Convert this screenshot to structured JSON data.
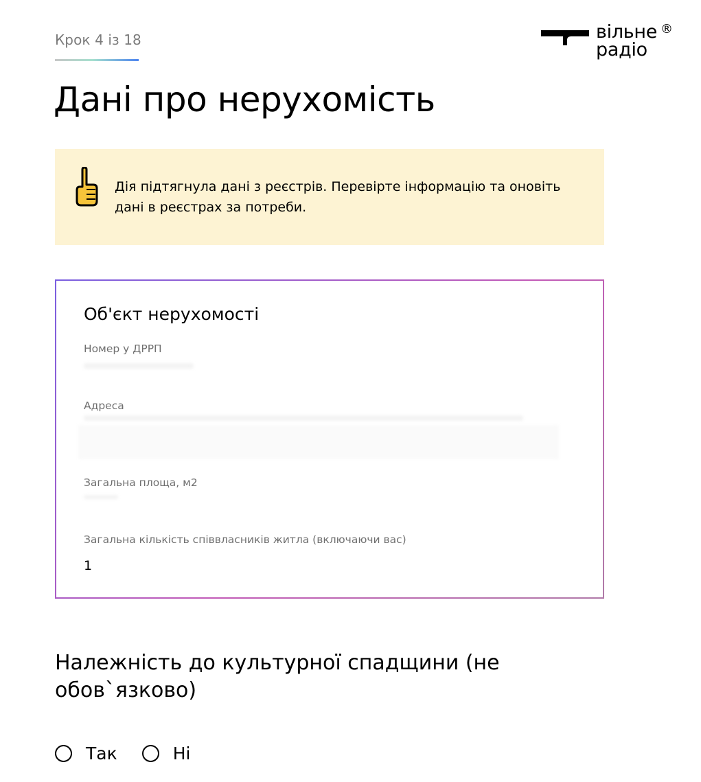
{
  "header": {
    "step_text": "Крок 4 із 18",
    "logo_line1": "вільне",
    "logo_line2": "радіо",
    "logo_reg": "®"
  },
  "page": {
    "title": "Дані про нерухомість"
  },
  "notice": {
    "icon": "pointing-up-hand-icon",
    "text": "Дія підтягнула дані з реєстрів. Перевірте інформацію та оновіть дані в реєстрах за потреби."
  },
  "property_card": {
    "title": "Об'єкт нерухомості",
    "fields": [
      {
        "label": "Номер у ДРРП",
        "value": ""
      },
      {
        "label": "Адреса",
        "value": ""
      },
      {
        "label": "Загальна площа, м2",
        "value": ""
      },
      {
        "label": "Загальна кількість співвласників житла (включаючи вас)",
        "value": "1"
      }
    ]
  },
  "heritage": {
    "title": "Належність до культурної спадщини (не обов`язково)",
    "options": [
      {
        "label": "Так",
        "selected": false
      },
      {
        "label": "Ні",
        "selected": false
      }
    ]
  },
  "colors": {
    "notice_bg": "#fdf3d3",
    "card_border_start": "#7a5fe0",
    "card_border_end": "#c25ab7",
    "muted_text": "#6f6f6f"
  }
}
